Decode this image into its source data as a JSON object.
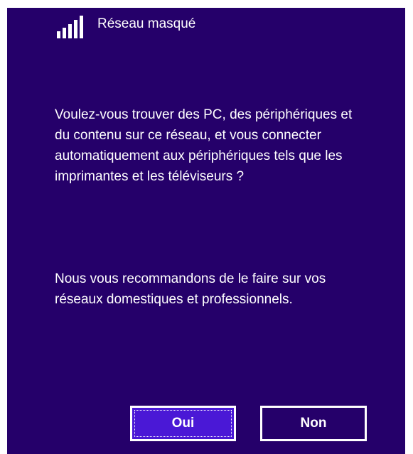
{
  "network": {
    "name": "Réseau masqué",
    "icon": "wifi-signal-icon"
  },
  "prompt": {
    "question": "Voulez-vous trouver des PC, des périphériques et du contenu sur ce réseau, et vous connecter automatiquement aux périphériques tels que les imprimantes et les téléviseurs ?",
    "recommendation": "Nous vous recommandons de le faire sur vos réseaux domestiques et professionnels."
  },
  "buttons": {
    "yes_label": "Oui",
    "no_label": "Non"
  },
  "colors": {
    "background": "#25006a",
    "accent": "#4a18d6",
    "text": "#ffffff"
  }
}
